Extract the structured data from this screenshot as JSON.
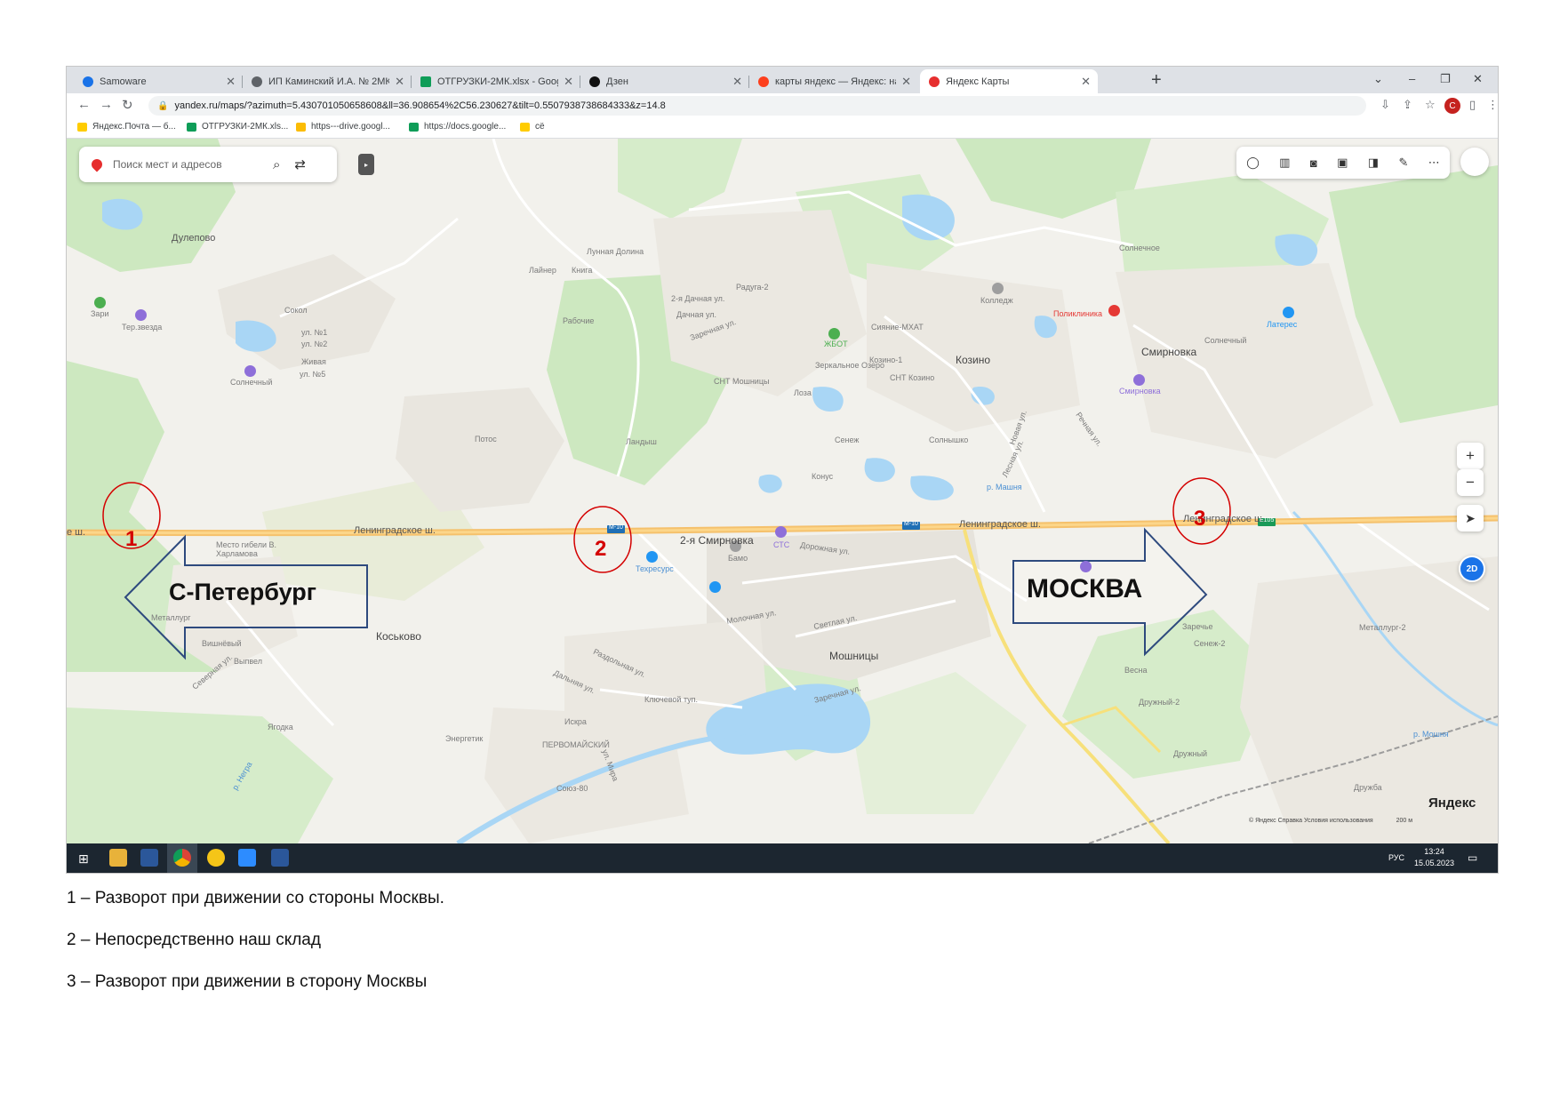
{
  "browser": {
    "tabs": [
      {
        "title": "Samoware"
      },
      {
        "title": "ИП Каминский И.А. № 2МК-11·"
      },
      {
        "title": "ОТГРУЗКИ-2МК.xlsx - Google Та"
      },
      {
        "title": "Дзен"
      },
      {
        "title": "карты яндекс — Яндекс: нашлос"
      },
      {
        "title": "Яндекс Карты"
      }
    ],
    "url": "yandex.ru/maps/?azimuth=5.430701050658608&ll=36.908654%2C56.230627&tilt=0.5507938738684333&z=14.8",
    "profile_initial": "С",
    "bookmarks": [
      {
        "label": "Яндекс.Почта — б..."
      },
      {
        "label": "ОТГРУЗКИ-2МК.xls..."
      },
      {
        "label": "https---drive.googl..."
      },
      {
        "label": "https://docs.google..."
      },
      {
        "label": "сё"
      }
    ]
  },
  "map": {
    "search_placeholder": "Поиск мест и адресов",
    "logo": "Яндекс",
    "copyright": "© Яндекс   Справка   Условия использования",
    "scale": "200 м",
    "btn_2d": "2D",
    "place_labels": [
      "Дулепово",
      "Зари",
      "Тер.звезда",
      "Сокол",
      "ул. №1",
      "ул. №2",
      "Живая",
      "ул. №5",
      "Солнечный",
      "Лунная Долина",
      "Лайнер",
      "Книга",
      "Рабочие",
      "2-я Дачная ул.",
      "Дачная ул.",
      "Радуга-2",
      "Заречная ул.",
      "ЖБОТ",
      "Сияние-МХАТ",
      "Колледж",
      "Поликлиника",
      "Солнечное",
      "Латерес",
      "Смирновка",
      "Солнечный",
      "Смирновка",
      "Козино",
      "Козино-1",
      "СНТ Козино",
      "СНТ Мошницы",
      "Зеркальное Озеро",
      "Лоза",
      "Потос",
      "Ландыш",
      "Сенеж",
      "Солнышко",
      "Конус",
      "Новая ул.",
      "Речная ул.",
      "Лесная ул.",
      "р. Машня",
      "2-я Смирновка",
      "СТС",
      "Дорожная ул.",
      "Бамо",
      "Техресурс",
      "Место гибели В. Харламова",
      "Металлург",
      "Вишнёвый",
      "Выпвел",
      "Северная ул.",
      "Коськово",
      "Мошницы",
      "Ключевой туп.",
      "Заречная ул.",
      "Раздольная ул.",
      "Дальняя ул.",
      "Искра",
      "Энергетик",
      "ПЕРВОМАЙСКИЙ",
      "ул. Мира",
      "Союз-80",
      "Ягодка",
      "р. Негра",
      "Весна",
      "Дружный-2",
      "Дружный",
      "Дружба",
      "Металлург-2",
      "Сенеж-2",
      "р. Мошня",
      "Заречье",
      "Светлая ул.",
      "Молочная ул."
    ],
    "road_labels": [
      "Ленинградское ш.",
      "Ленинградское ш.",
      "Ленинградское ш.",
      "М-10",
      "М-10",
      "Е105",
      "е ш."
    ],
    "annotations": {
      "marker_1": "1",
      "marker_2": "2",
      "marker_3": "3",
      "arrow_left": "С-Петербург",
      "arrow_right": "МОСКВА"
    }
  },
  "taskbar": {
    "lang": "РУС",
    "time": "13:24",
    "date": "15.05.2023"
  },
  "captions": [
    "1 – Разворот при движении со стороны Москвы.",
    "2 – Непосредственно наш склад",
    "3 – Разворот при движении в сторону Москвы"
  ]
}
